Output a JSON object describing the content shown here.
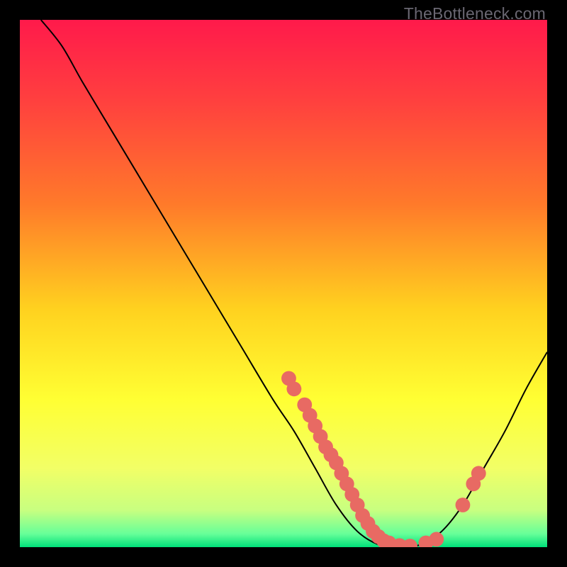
{
  "watermark": "TheBottleneck.com",
  "chart_data": {
    "type": "line",
    "title": "",
    "xlabel": "",
    "ylabel": "",
    "xlim": [
      0,
      100
    ],
    "ylim": [
      0,
      100
    ],
    "gradient_stops": [
      {
        "offset": 0,
        "color": "#ff1a4b"
      },
      {
        "offset": 0.15,
        "color": "#ff3f3f"
      },
      {
        "offset": 0.35,
        "color": "#ff7a2a"
      },
      {
        "offset": 0.55,
        "color": "#ffd21f"
      },
      {
        "offset": 0.72,
        "color": "#ffff33"
      },
      {
        "offset": 0.85,
        "color": "#f2ff66"
      },
      {
        "offset": 0.93,
        "color": "#c8ff80"
      },
      {
        "offset": 0.975,
        "color": "#66ff99"
      },
      {
        "offset": 1.0,
        "color": "#00e07a"
      }
    ],
    "curve": [
      {
        "x": 4,
        "y": 100
      },
      {
        "x": 8,
        "y": 95
      },
      {
        "x": 12,
        "y": 88
      },
      {
        "x": 18,
        "y": 78
      },
      {
        "x": 24,
        "y": 68
      },
      {
        "x": 30,
        "y": 58
      },
      {
        "x": 36,
        "y": 48
      },
      {
        "x": 42,
        "y": 38
      },
      {
        "x": 48,
        "y": 28
      },
      {
        "x": 52,
        "y": 22
      },
      {
        "x": 56,
        "y": 15
      },
      {
        "x": 60,
        "y": 8
      },
      {
        "x": 64,
        "y": 3
      },
      {
        "x": 68,
        "y": 0.5
      },
      {
        "x": 72,
        "y": 0
      },
      {
        "x": 76,
        "y": 0.5
      },
      {
        "x": 80,
        "y": 3
      },
      {
        "x": 84,
        "y": 8
      },
      {
        "x": 88,
        "y": 15
      },
      {
        "x": 92,
        "y": 22
      },
      {
        "x": 96,
        "y": 30
      },
      {
        "x": 100,
        "y": 37
      }
    ],
    "markers": [
      {
        "x": 51,
        "y": 32
      },
      {
        "x": 52,
        "y": 30
      },
      {
        "x": 54,
        "y": 27
      },
      {
        "x": 55,
        "y": 25
      },
      {
        "x": 56,
        "y": 23
      },
      {
        "x": 57,
        "y": 21
      },
      {
        "x": 58,
        "y": 19
      },
      {
        "x": 59,
        "y": 17.5
      },
      {
        "x": 60,
        "y": 16
      },
      {
        "x": 61,
        "y": 14
      },
      {
        "x": 62,
        "y": 12
      },
      {
        "x": 63,
        "y": 10
      },
      {
        "x": 64,
        "y": 8
      },
      {
        "x": 65,
        "y": 6
      },
      {
        "x": 66,
        "y": 4.5
      },
      {
        "x": 67,
        "y": 3
      },
      {
        "x": 68,
        "y": 2
      },
      {
        "x": 69,
        "y": 1.2
      },
      {
        "x": 70,
        "y": 0.8
      },
      {
        "x": 72,
        "y": 0.3
      },
      {
        "x": 74,
        "y": 0.2
      },
      {
        "x": 77,
        "y": 0.8
      },
      {
        "x": 79,
        "y": 1.5
      },
      {
        "x": 84,
        "y": 8
      },
      {
        "x": 86,
        "y": 12
      },
      {
        "x": 87,
        "y": 14
      }
    ],
    "marker_color": "#e86a63",
    "marker_radius": 1.4
  }
}
